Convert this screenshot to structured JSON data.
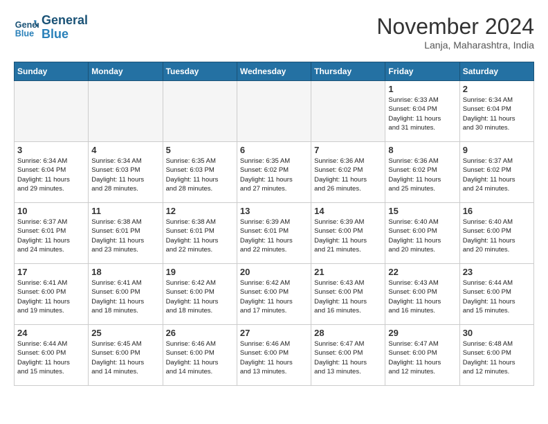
{
  "header": {
    "logo_line1": "General",
    "logo_line2": "Blue",
    "month": "November 2024",
    "location": "Lanja, Maharashtra, India"
  },
  "weekdays": [
    "Sunday",
    "Monday",
    "Tuesday",
    "Wednesday",
    "Thursday",
    "Friday",
    "Saturday"
  ],
  "weeks": [
    [
      {
        "day": "",
        "info": ""
      },
      {
        "day": "",
        "info": ""
      },
      {
        "day": "",
        "info": ""
      },
      {
        "day": "",
        "info": ""
      },
      {
        "day": "",
        "info": ""
      },
      {
        "day": "1",
        "info": "Sunrise: 6:33 AM\nSunset: 6:04 PM\nDaylight: 11 hours\nand 31 minutes."
      },
      {
        "day": "2",
        "info": "Sunrise: 6:34 AM\nSunset: 6:04 PM\nDaylight: 11 hours\nand 30 minutes."
      }
    ],
    [
      {
        "day": "3",
        "info": "Sunrise: 6:34 AM\nSunset: 6:04 PM\nDaylight: 11 hours\nand 29 minutes."
      },
      {
        "day": "4",
        "info": "Sunrise: 6:34 AM\nSunset: 6:03 PM\nDaylight: 11 hours\nand 28 minutes."
      },
      {
        "day": "5",
        "info": "Sunrise: 6:35 AM\nSunset: 6:03 PM\nDaylight: 11 hours\nand 28 minutes."
      },
      {
        "day": "6",
        "info": "Sunrise: 6:35 AM\nSunset: 6:02 PM\nDaylight: 11 hours\nand 27 minutes."
      },
      {
        "day": "7",
        "info": "Sunrise: 6:36 AM\nSunset: 6:02 PM\nDaylight: 11 hours\nand 26 minutes."
      },
      {
        "day": "8",
        "info": "Sunrise: 6:36 AM\nSunset: 6:02 PM\nDaylight: 11 hours\nand 25 minutes."
      },
      {
        "day": "9",
        "info": "Sunrise: 6:37 AM\nSunset: 6:02 PM\nDaylight: 11 hours\nand 24 minutes."
      }
    ],
    [
      {
        "day": "10",
        "info": "Sunrise: 6:37 AM\nSunset: 6:01 PM\nDaylight: 11 hours\nand 24 minutes."
      },
      {
        "day": "11",
        "info": "Sunrise: 6:38 AM\nSunset: 6:01 PM\nDaylight: 11 hours\nand 23 minutes."
      },
      {
        "day": "12",
        "info": "Sunrise: 6:38 AM\nSunset: 6:01 PM\nDaylight: 11 hours\nand 22 minutes."
      },
      {
        "day": "13",
        "info": "Sunrise: 6:39 AM\nSunset: 6:01 PM\nDaylight: 11 hours\nand 22 minutes."
      },
      {
        "day": "14",
        "info": "Sunrise: 6:39 AM\nSunset: 6:00 PM\nDaylight: 11 hours\nand 21 minutes."
      },
      {
        "day": "15",
        "info": "Sunrise: 6:40 AM\nSunset: 6:00 PM\nDaylight: 11 hours\nand 20 minutes."
      },
      {
        "day": "16",
        "info": "Sunrise: 6:40 AM\nSunset: 6:00 PM\nDaylight: 11 hours\nand 20 minutes."
      }
    ],
    [
      {
        "day": "17",
        "info": "Sunrise: 6:41 AM\nSunset: 6:00 PM\nDaylight: 11 hours\nand 19 minutes."
      },
      {
        "day": "18",
        "info": "Sunrise: 6:41 AM\nSunset: 6:00 PM\nDaylight: 11 hours\nand 18 minutes."
      },
      {
        "day": "19",
        "info": "Sunrise: 6:42 AM\nSunset: 6:00 PM\nDaylight: 11 hours\nand 18 minutes."
      },
      {
        "day": "20",
        "info": "Sunrise: 6:42 AM\nSunset: 6:00 PM\nDaylight: 11 hours\nand 17 minutes."
      },
      {
        "day": "21",
        "info": "Sunrise: 6:43 AM\nSunset: 6:00 PM\nDaylight: 11 hours\nand 16 minutes."
      },
      {
        "day": "22",
        "info": "Sunrise: 6:43 AM\nSunset: 6:00 PM\nDaylight: 11 hours\nand 16 minutes."
      },
      {
        "day": "23",
        "info": "Sunrise: 6:44 AM\nSunset: 6:00 PM\nDaylight: 11 hours\nand 15 minutes."
      }
    ],
    [
      {
        "day": "24",
        "info": "Sunrise: 6:44 AM\nSunset: 6:00 PM\nDaylight: 11 hours\nand 15 minutes."
      },
      {
        "day": "25",
        "info": "Sunrise: 6:45 AM\nSunset: 6:00 PM\nDaylight: 11 hours\nand 14 minutes."
      },
      {
        "day": "26",
        "info": "Sunrise: 6:46 AM\nSunset: 6:00 PM\nDaylight: 11 hours\nand 14 minutes."
      },
      {
        "day": "27",
        "info": "Sunrise: 6:46 AM\nSunset: 6:00 PM\nDaylight: 11 hours\nand 13 minutes."
      },
      {
        "day": "28",
        "info": "Sunrise: 6:47 AM\nSunset: 6:00 PM\nDaylight: 11 hours\nand 13 minutes."
      },
      {
        "day": "29",
        "info": "Sunrise: 6:47 AM\nSunset: 6:00 PM\nDaylight: 11 hours\nand 12 minutes."
      },
      {
        "day": "30",
        "info": "Sunrise: 6:48 AM\nSunset: 6:00 PM\nDaylight: 11 hours\nand 12 minutes."
      }
    ]
  ]
}
